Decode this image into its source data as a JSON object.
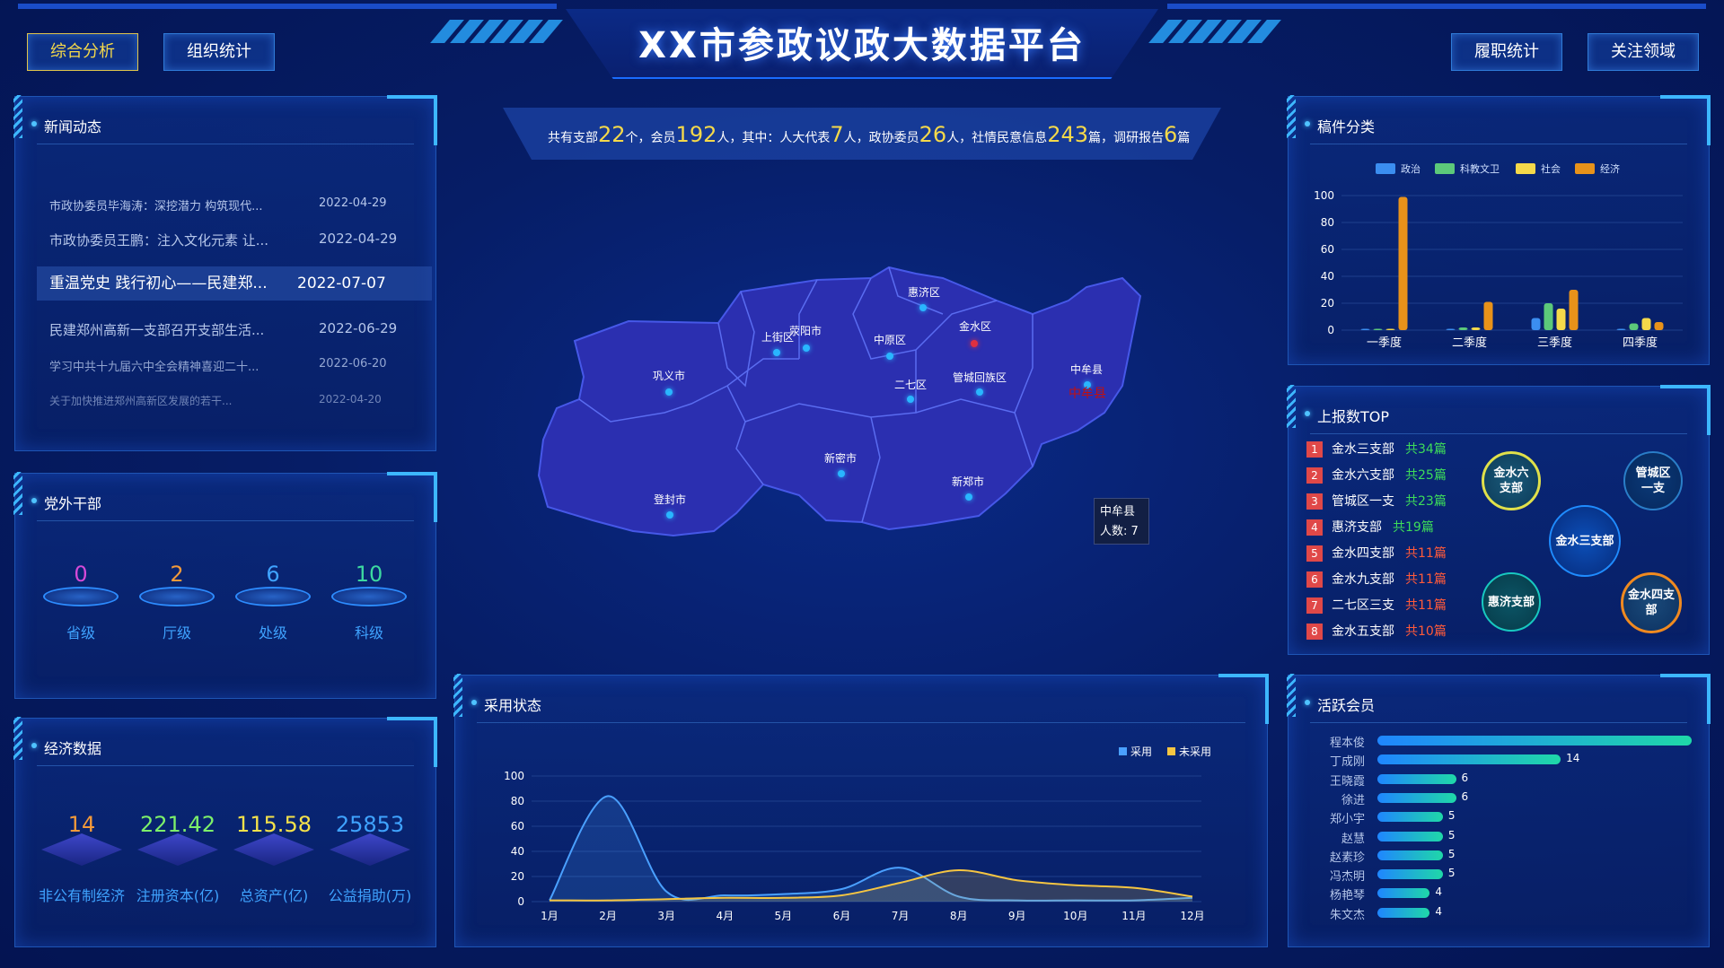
{
  "header": {
    "title": "XX市参政议政大数据平台"
  },
  "nav": {
    "left": [
      "综合分析",
      "组织统计"
    ],
    "right": [
      "履职统计",
      "关注领域"
    ]
  },
  "news": {
    "title": "新闻动态",
    "items": [
      {
        "text": "市政协委员毕海涛：深挖潜力 构筑现代...",
        "date": "2022-04-29"
      },
      {
        "text": "市政协委员王鹏：注入文化元素 让...",
        "date": "2022-04-29"
      },
      {
        "text": "重温党史 践行初心——民建郑...",
        "date": "2022-07-07"
      },
      {
        "text": "民建郑州高新一支部召开支部生活...",
        "date": "2022-06-29"
      },
      {
        "text": "学习中共十九届六中全会精神喜迎二十...",
        "date": "2022-06-20"
      },
      {
        "text": "关于加快推进郑州高新区发展的若干...",
        "date": "2022-04-20"
      }
    ]
  },
  "cadres": {
    "title": "党外干部",
    "items": [
      {
        "value": "0",
        "label": "省级",
        "color": "#d54ad8"
      },
      {
        "value": "2",
        "label": "厅级",
        "color": "#f39a3a"
      },
      {
        "value": "6",
        "label": "处级",
        "color": "#3fa3ff"
      },
      {
        "value": "10",
        "label": "科级",
        "color": "#3dd9a0"
      }
    ]
  },
  "economy": {
    "title": "经济数据",
    "items": [
      {
        "value": "14",
        "label": "非公有制经济",
        "color": "#f39a3a"
      },
      {
        "value": "221.42",
        "label": "注册资本(亿)",
        "color": "#7df06a"
      },
      {
        "value": "115.58",
        "label": "总资产(亿)",
        "color": "#f5e24a"
      },
      {
        "value": "25853",
        "label": "公益捐助(万)",
        "color": "#3fa3ff"
      }
    ]
  },
  "summary": {
    "p1": "共有支部",
    "v1": "22",
    "p2": "个，会员",
    "v2": "192",
    "p3": "人，其中：人大代表",
    "v3": "7",
    "p4": "人，政协委员",
    "v4": "26",
    "p5": "人，社情民意信息",
    "v5": "243",
    "p6": "篇，调研报告",
    "v6": "6",
    "p7": "篇"
  },
  "map": {
    "regions": [
      {
        "name": "惠济区"
      },
      {
        "name": "上街区"
      },
      {
        "name": "荥阳市"
      },
      {
        "name": "中原区"
      },
      {
        "name": "金水区"
      },
      {
        "name": "中牟县"
      },
      {
        "name": "巩义市"
      },
      {
        "name": "二七区"
      },
      {
        "name": "管城回族区"
      },
      {
        "name": "新密市"
      },
      {
        "name": "新郑市"
      },
      {
        "name": "登封市"
      }
    ],
    "highlight": "中牟县",
    "tooltip": {
      "name": "中牟县",
      "count": "人数: 7"
    }
  },
  "manuscript": {
    "title": "稿件分类",
    "chart_data": {
      "type": "bar",
      "categories": [
        "一季度",
        "二季度",
        "三季度",
        "四季度"
      ],
      "series": [
        {
          "name": "政治",
          "values": [
            1,
            1,
            9,
            1
          ],
          "color": "#3b8ef0"
        },
        {
          "name": "科教文卫",
          "values": [
            1,
            2,
            20,
            5
          ],
          "color": "#5cc97a"
        },
        {
          "name": "社会",
          "values": [
            1,
            2,
            16,
            9
          ],
          "color": "#f5d94a"
        },
        {
          "name": "经济",
          "values": [
            99,
            21,
            30,
            6
          ],
          "color": "#e8921a"
        }
      ],
      "ylim": [
        0,
        100
      ],
      "yticks": [
        0,
        20,
        40,
        60,
        80,
        100
      ]
    }
  },
  "top": {
    "title": "上报数TOP",
    "items": [
      {
        "rank": "1",
        "name": "金水三支部",
        "count": "共34篇",
        "color": "#3ddc5a"
      },
      {
        "rank": "2",
        "name": "金水六支部",
        "count": "共25篇",
        "color": "#3ddc5a"
      },
      {
        "rank": "3",
        "name": "管城区一支",
        "count": "共23篇",
        "color": "#3ddc5a"
      },
      {
        "rank": "4",
        "name": "惠济支部",
        "count": "共19篇",
        "color": "#3ddc5a"
      },
      {
        "rank": "5",
        "name": "金水四支部",
        "count": "共11篇",
        "color": "#ff5a3a"
      },
      {
        "rank": "6",
        "name": "金水九支部",
        "count": "共11篇",
        "color": "#ff5a3a"
      },
      {
        "rank": "7",
        "name": "二七区三支",
        "count": "共11篇",
        "color": "#ff5a3a"
      },
      {
        "rank": "8",
        "name": "金水五支部",
        "count": "共10篇",
        "color": "#ff5a3a"
      }
    ],
    "bubbles": [
      {
        "text": "金水六\n支部"
      },
      {
        "text": "管城区\n一支"
      },
      {
        "text": "金水三支部"
      },
      {
        "text": "惠济支部"
      },
      {
        "text": "金水四支\n部"
      }
    ]
  },
  "adoption": {
    "title": "采用状态",
    "chart_data": {
      "type": "area",
      "x": [
        "1月",
        "2月",
        "3月",
        "4月",
        "5月",
        "6月",
        "7月",
        "8月",
        "9月",
        "10月",
        "11月",
        "12月"
      ],
      "series": [
        {
          "name": "采用",
          "values": [
            1,
            84,
            8,
            5,
            6,
            10,
            27,
            4,
            1,
            1,
            1,
            3
          ],
          "color": "#4aa0ff"
        },
        {
          "name": "未采用",
          "values": [
            1,
            1,
            2,
            3,
            3,
            5,
            15,
            25,
            17,
            13,
            11,
            4
          ],
          "color": "#f5c542"
        }
      ],
      "ylim": [
        0,
        100
      ],
      "yticks": [
        0,
        20,
        40,
        60,
        80,
        100
      ]
    }
  },
  "members": {
    "title": "活跃会员",
    "max": 24,
    "items": [
      {
        "name": "程本俊",
        "value": 24,
        "label": ""
      },
      {
        "name": "丁成刚",
        "value": 14,
        "label": "14"
      },
      {
        "name": "王晓霞",
        "value": 6,
        "label": "6"
      },
      {
        "name": "徐进",
        "value": 6,
        "label": "6"
      },
      {
        "name": "郑小宇",
        "value": 5,
        "label": "5"
      },
      {
        "name": "赵慧",
        "value": 5,
        "label": "5"
      },
      {
        "name": "赵素珍",
        "value": 5,
        "label": "5"
      },
      {
        "name": "冯杰明",
        "value": 5,
        "label": "5"
      },
      {
        "name": "杨艳琴",
        "value": 4,
        "label": "4"
      },
      {
        "name": "朱文杰",
        "value": 4,
        "label": "4"
      }
    ]
  }
}
